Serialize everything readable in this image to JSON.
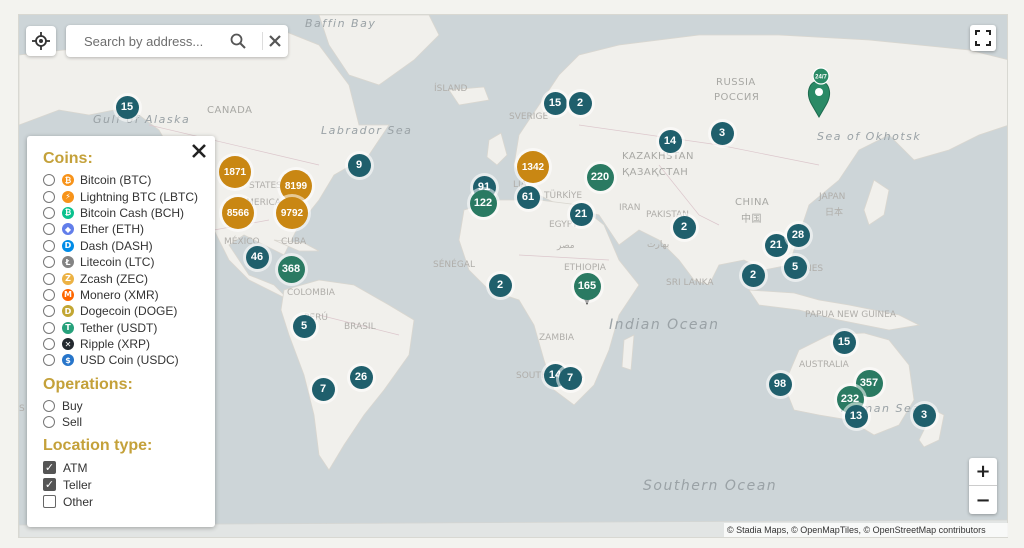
{
  "search": {
    "placeholder": "Search by address..."
  },
  "attribution": "© Stadia Maps, © OpenMapTiles, © OpenStreetMap contributors",
  "zoom": {
    "in_label": "+",
    "out_label": "−"
  },
  "panel": {
    "coins_title": "Coins:",
    "coins": [
      {
        "label": "Bitcoin (BTC)",
        "icon": "bitcoin-icon",
        "color": "#f7931a",
        "glyph": "₿"
      },
      {
        "label": "Lightning BTC (LBTC)",
        "icon": "lightning-icon",
        "color": "#f7931a",
        "glyph": "⚡"
      },
      {
        "label": "Bitcoin Cash (BCH)",
        "icon": "bitcoin-cash-icon",
        "color": "#0ac18e",
        "glyph": "₿"
      },
      {
        "label": "Ether (ETH)",
        "icon": "ethereum-icon",
        "color": "#627eea",
        "glyph": "◆"
      },
      {
        "label": "Dash (DASH)",
        "icon": "dash-icon",
        "color": "#008ce7",
        "glyph": "D"
      },
      {
        "label": "Litecoin (LTC)",
        "icon": "litecoin-icon",
        "color": "#838383",
        "glyph": "Ł"
      },
      {
        "label": "Zcash (ZEC)",
        "icon": "zcash-icon",
        "color": "#ecb244",
        "glyph": "Z"
      },
      {
        "label": "Monero (XMR)",
        "icon": "monero-icon",
        "color": "#ff6600",
        "glyph": "M"
      },
      {
        "label": "Dogecoin (DOGE)",
        "icon": "dogecoin-icon",
        "color": "#c2a633",
        "glyph": "D"
      },
      {
        "label": "Tether (USDT)",
        "icon": "tether-icon",
        "color": "#26a17b",
        "glyph": "T"
      },
      {
        "label": "Ripple (XRP)",
        "icon": "ripple-icon",
        "color": "#23292f",
        "glyph": "✕"
      },
      {
        "label": "USD Coin (USDC)",
        "icon": "usdc-icon",
        "color": "#2775ca",
        "glyph": "$"
      }
    ],
    "operations_title": "Operations:",
    "operations": [
      {
        "label": "Buy"
      },
      {
        "label": "Sell"
      }
    ],
    "location_title": "Location type:",
    "location_types": [
      {
        "label": "ATM",
        "checked": true
      },
      {
        "label": "Teller",
        "checked": true
      },
      {
        "label": "Other",
        "checked": false
      }
    ]
  },
  "map_labels": {
    "baffin_bay": "Baffin Bay",
    "gulf_alaska": "Gulf of Alaska",
    "canada": "CANADA",
    "labrador_sea": "Labrador Sea",
    "island": "ÍSLAND",
    "sverige": "SVERIGE",
    "russia": "RUSSIA",
    "russia_cyr": "РОССИЯ",
    "sea_okhotsk": "Sea of Okhotsk",
    "kazakhstan": "KAZAKHSTAN",
    "kazakhstan_cyr": "ҚАЗАҚСТАН",
    "turkiye": "TÜRKİYE",
    "iran": "IRAN",
    "pakistan": "PAKISTAN",
    "china": "CHINA",
    "china_cjk": "中国",
    "japan": "JAPAN",
    "japan_cjk": "日本",
    "egypt": "EGYPT",
    "egypt_ar": "مصر",
    "senegal": "SÉNÉGAL",
    "ethiopia": "ETHIOPIA",
    "sri_lanka": "SRI LANKA",
    "philippines": "NES",
    "new_guinea": "PAPUA NEW GUINEA",
    "indian_ocean": "Indian Ocean",
    "zambia": "ZAMBIA",
    "south_africa": "SOUTH AFRICA",
    "australia": "AUSTRALIA",
    "tasman": "Tasman Sea",
    "southern_ocean": "Southern Ocean",
    "states": "STATES",
    "america": "AMERICA",
    "mexico": "MÉXICO",
    "cuba": "CUBA",
    "colombia": "COLOMBIA",
    "peru": "PERÚ",
    "brasil": "BRASIL",
    "india_fragment": "بھارت",
    "ireland_fragment": "LIA",
    "chile_fragment": "S"
  },
  "clusters": [
    {
      "count": "15",
      "tier": "small"
    },
    {
      "count": "1871",
      "tier": "large"
    },
    {
      "count": "8199",
      "tier": "large"
    },
    {
      "count": "8566",
      "tier": "large"
    },
    {
      "count": "9792",
      "tier": "large"
    },
    {
      "count": "9",
      "tier": "small"
    },
    {
      "count": "46",
      "tier": "small"
    },
    {
      "count": "368",
      "tier": "medium"
    },
    {
      "count": "5",
      "tier": "small"
    },
    {
      "count": "26",
      "tier": "small"
    },
    {
      "count": "7",
      "tier": "small"
    },
    {
      "count": "15",
      "tier": "small"
    },
    {
      "count": "2",
      "tier": "small"
    },
    {
      "count": "1342",
      "tier": "large"
    },
    {
      "count": "91",
      "tier": "small"
    },
    {
      "count": "122",
      "tier": "medium"
    },
    {
      "count": "61",
      "tier": "small"
    },
    {
      "count": "220",
      "tier": "medium"
    },
    {
      "count": "21",
      "tier": "small"
    },
    {
      "count": "14",
      "tier": "small"
    },
    {
      "count": "3",
      "tier": "small"
    },
    {
      "count": "2",
      "tier": "small"
    },
    {
      "count": "2",
      "tier": "small"
    },
    {
      "count": "165",
      "tier": "medium"
    },
    {
      "count": "21",
      "tier": "small"
    },
    {
      "count": "28",
      "tier": "small"
    },
    {
      "count": "5",
      "tier": "small"
    },
    {
      "count": "2",
      "tier": "small"
    },
    {
      "count": "14",
      "tier": "small"
    },
    {
      "count": "7",
      "tier": "small"
    },
    {
      "count": "15",
      "tier": "small"
    },
    {
      "count": "98",
      "tier": "small"
    },
    {
      "count": "357",
      "tier": "medium"
    },
    {
      "count": "232",
      "tier": "medium"
    },
    {
      "count": "13",
      "tier": "small"
    },
    {
      "count": "3",
      "tier": "small"
    }
  ],
  "pin": {
    "badge": "24/7"
  },
  "colors": {
    "small": "#1f5f6c",
    "medium": "#2a7a62",
    "large": "#c98713",
    "accent": "#c4a13a"
  }
}
